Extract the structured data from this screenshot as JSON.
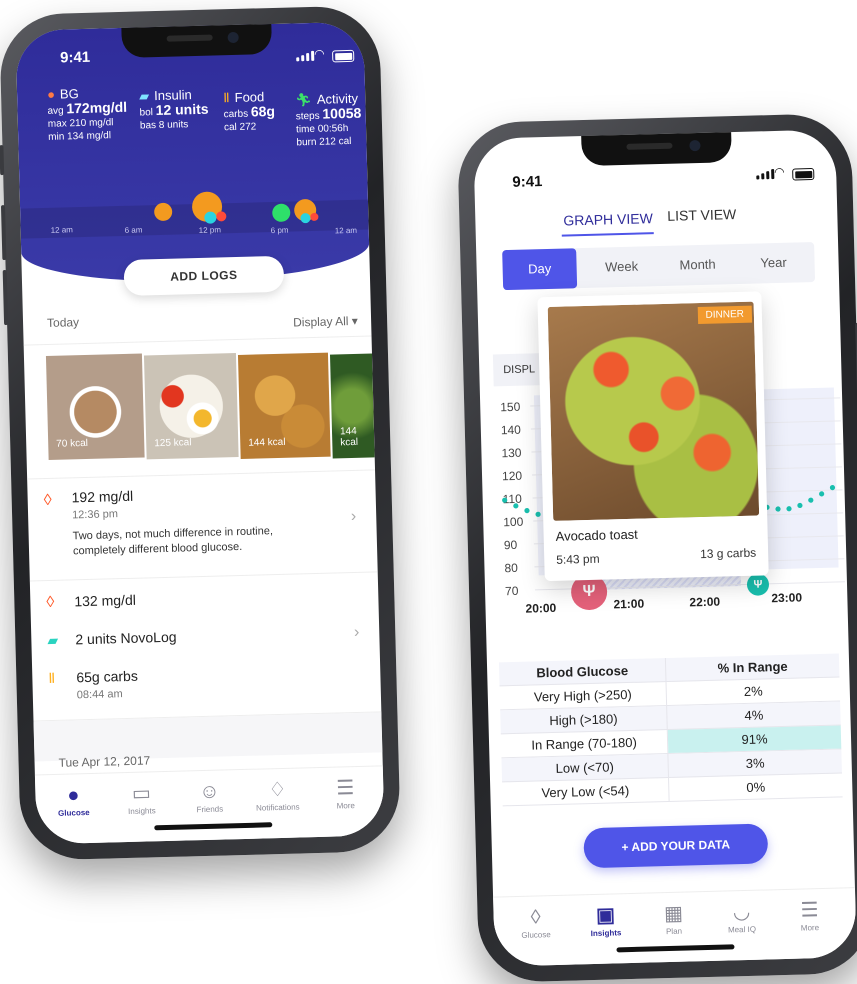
{
  "left": {
    "status_time": "9:41",
    "stats": {
      "bg": {
        "title": "BG",
        "avg_label": "avg",
        "avg_value": "172mg/dl",
        "max_label": "max",
        "max_value": "210 mg/dl",
        "min_label": "min",
        "min_value": "134 mg/dl"
      },
      "insulin": {
        "title": "Insulin",
        "bol_label": "bol",
        "bol_value": "12 units",
        "bas_label": "bas",
        "bas_value": "8 units"
      },
      "food": {
        "title": "Food",
        "carbs_label": "carbs",
        "carbs_value": "68g",
        "cal_label": "cal",
        "cal_value": "272"
      },
      "activity": {
        "title": "Activity",
        "steps_label": "steps",
        "steps_value": "10058",
        "time_label": "time",
        "time_value": "00:56h",
        "burn_label": "burn",
        "burn_value": "212 cal"
      }
    },
    "timeline": [
      "12 am",
      "6 am",
      "12 pm",
      "6 pm",
      "12 am"
    ],
    "add_logs": "ADD LOGS",
    "today": "Today",
    "display_all": "Display All ▾",
    "photos": [
      {
        "label": "70 kcal",
        "name": "coffee"
      },
      {
        "label": "125 kcal",
        "name": "eggs-tomato"
      },
      {
        "label": "144 kcal",
        "name": "croissants"
      },
      {
        "label": "144 kcal",
        "name": "salad"
      }
    ],
    "entries": {
      "e1_value": "192 mg/dl",
      "e1_time": "12:36 pm",
      "e1_note": "Two days, not much difference in routine, completely different blood glucose.",
      "e2_value": "132 mg/dl",
      "e3_value": "2 units NovoLog",
      "e4_value": "65g carbs",
      "e4_time": "08:44 am"
    },
    "date": "Tue Apr 12, 2017",
    "tabs": [
      "Glucose",
      "Insights",
      "Friends",
      "Notifications",
      "More"
    ]
  },
  "right": {
    "status_time": "9:41",
    "view_tabs": [
      "GRAPH VIEW",
      "LIST VIEW"
    ],
    "segments": [
      "Day",
      "Week",
      "Month",
      "Year"
    ],
    "display_label": "DISPL",
    "y_ticks": [
      "150",
      "140",
      "130",
      "120",
      "110",
      "100",
      "90",
      "80",
      "70"
    ],
    "x_ticks": [
      "20:00",
      "21:00",
      "22:00",
      "23:00"
    ],
    "card": {
      "badge": "DINNER",
      "title": "Avocado toast",
      "time": "5:43 pm",
      "carbs": "13 g carbs"
    },
    "table": {
      "headers": [
        "Blood Glucose",
        "% In Range"
      ],
      "rows": [
        [
          "Very High (>250)",
          "2%"
        ],
        [
          "High (>180)",
          "4%"
        ],
        [
          "In Range (70-180)",
          "91%"
        ],
        [
          "Low (<70)",
          "3%"
        ],
        [
          "Very Low (<54)",
          "0%"
        ]
      ]
    },
    "add_data": "+ ADD YOUR DATA",
    "tabs": [
      "Glucose",
      "Insights",
      "Plan",
      "Meal IQ",
      "More"
    ]
  },
  "colors": {
    "brand": "#2f2c9a",
    "accent": "#4f55e8",
    "teal": "#19bfae",
    "in_range_highlight": "#c9f1ef",
    "card_badge": "#f29a2e"
  }
}
